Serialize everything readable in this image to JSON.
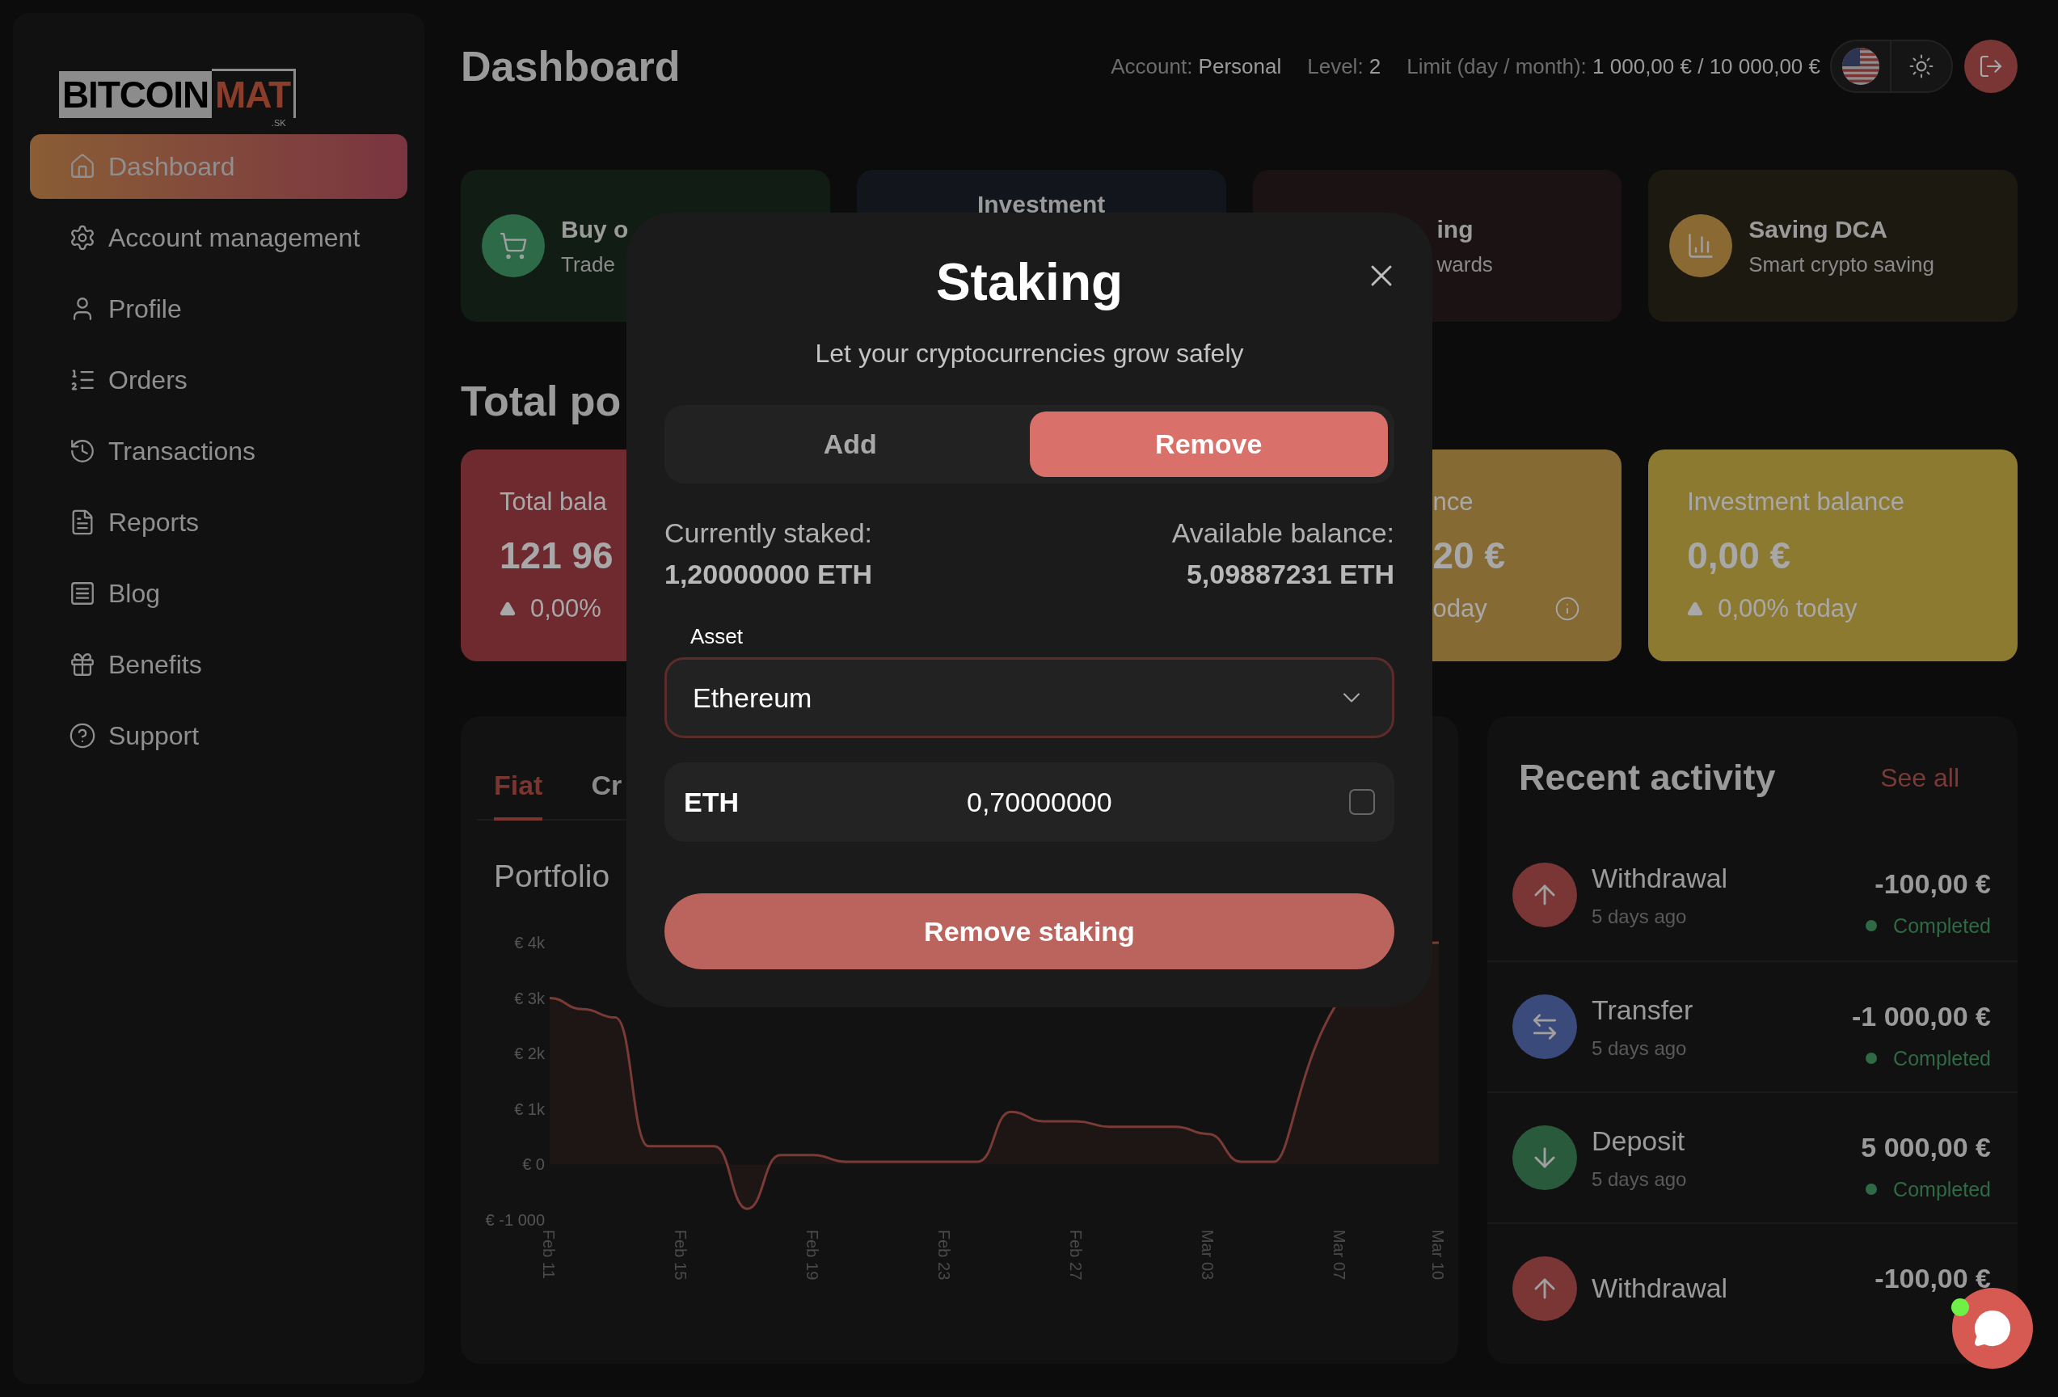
{
  "logo": {
    "wordmark": "BITCOIN",
    "accent": "MAT",
    "suffix": ".SK"
  },
  "sidebar": {
    "items": [
      {
        "label": "Dashboard",
        "selected": true
      },
      {
        "label": "Account management",
        "selected": false
      },
      {
        "label": "Profile",
        "selected": false
      },
      {
        "label": "Orders",
        "selected": false
      },
      {
        "label": "Transactions",
        "selected": false
      },
      {
        "label": "Reports",
        "selected": false
      },
      {
        "label": "Blog",
        "selected": false
      },
      {
        "label": "Benefits",
        "selected": false
      },
      {
        "label": "Support",
        "selected": false
      }
    ]
  },
  "header": {
    "title": "Dashboard",
    "account": {
      "label": "Account:",
      "value": "Personal"
    },
    "level": {
      "label": "Level:",
      "value": "2"
    },
    "limit": {
      "label": "Limit (day / month):",
      "value": "1 000,00 € / 10 000,00 €"
    }
  },
  "feature_cards": [
    {
      "kind": "buy",
      "title": "Buy o",
      "subtitle": "Trade"
    },
    {
      "kind": "investment",
      "title": "Investment"
    },
    {
      "kind": "staking",
      "title": "ing",
      "subtitle": "wards"
    },
    {
      "kind": "saving",
      "title": "Saving DCA",
      "subtitle": "Smart crypto saving"
    }
  ],
  "portfolio_heading": "Total po",
  "balance_cards": [
    {
      "kind": "total",
      "label": "Total bala",
      "amount": "121 96",
      "change": "0,00%"
    },
    {
      "kind": "fiat",
      "label": "nce",
      "amount": "20 €",
      "change": "oday"
    },
    {
      "kind": "investment",
      "label": "Investment balance",
      "amount": "0,00 €",
      "change": "0,00% today"
    }
  ],
  "portfolio": {
    "tabs": [
      {
        "label": "Fiat",
        "selected": true
      },
      {
        "label": "Cr",
        "selected": false
      }
    ],
    "title": "Portfolio",
    "chart_data": {
      "type": "area",
      "categories": [
        "Feb 11",
        null,
        null,
        null,
        "Feb 15",
        null,
        null,
        null,
        "Feb 19",
        null,
        null,
        null,
        "Feb 23",
        null,
        null,
        null,
        "Feb 27",
        null,
        null,
        null,
        "Mar 03",
        null,
        null,
        null,
        "Mar 07",
        null,
        null,
        "Mar 10"
      ],
      "series": [
        {
          "color": "#7a3a35",
          "values": [
            3000,
            2800,
            2650,
            330,
            330,
            330,
            -800,
            170,
            170,
            50,
            50,
            50,
            50,
            50,
            950,
            780,
            780,
            680,
            680,
            680,
            550,
            50,
            50,
            null,
            null,
            null,
            null,
            4000
          ]
        }
      ],
      "ylim": [
        -1000,
        4000
      ],
      "yticks": [
        {
          "value": 4000,
          "label": "€ 4k"
        },
        {
          "value": 3000,
          "label": "€ 3k"
        },
        {
          "value": 2000,
          "label": "€ 2k"
        },
        {
          "value": 1000,
          "label": "€ 1k"
        },
        {
          "value": 0,
          "label": "€ 0"
        },
        {
          "value": -1000,
          "label": "€ -1 000"
        }
      ]
    }
  },
  "recent_activity": {
    "title": "Recent activity",
    "link": "See all",
    "items": [
      {
        "kind": "withdrawal",
        "title": "Withdrawal",
        "time": "5 days ago",
        "amount": "-100,00 €",
        "status": "Completed"
      },
      {
        "kind": "transfer",
        "title": "Transfer",
        "time": "5 days ago",
        "amount": "-1 000,00 €",
        "status": "Completed"
      },
      {
        "kind": "deposit",
        "title": "Deposit",
        "time": "5 days ago",
        "amount": "5 000,00 €",
        "status": "Completed"
      },
      {
        "kind": "withdrawal",
        "title": "Withdrawal",
        "amount": "-100,00 €"
      }
    ]
  },
  "chat": {
    "online": true
  },
  "modal": {
    "title": "Staking",
    "subtitle": "Let your cryptocurrencies grow safely",
    "tabs": [
      {
        "label": "Add",
        "selected": false
      },
      {
        "label": "Remove",
        "selected": true
      }
    ],
    "staked": {
      "label": "Currently staked:",
      "value": "1,20000000 ETH"
    },
    "available": {
      "label": "Available balance:",
      "value": "5,09887231 ETH"
    },
    "asset": {
      "label": "Asset",
      "value": "Ethereum"
    },
    "amount": {
      "currency": "ETH",
      "value": "0,70000000",
      "checked": false
    },
    "submit": "Remove staking"
  }
}
